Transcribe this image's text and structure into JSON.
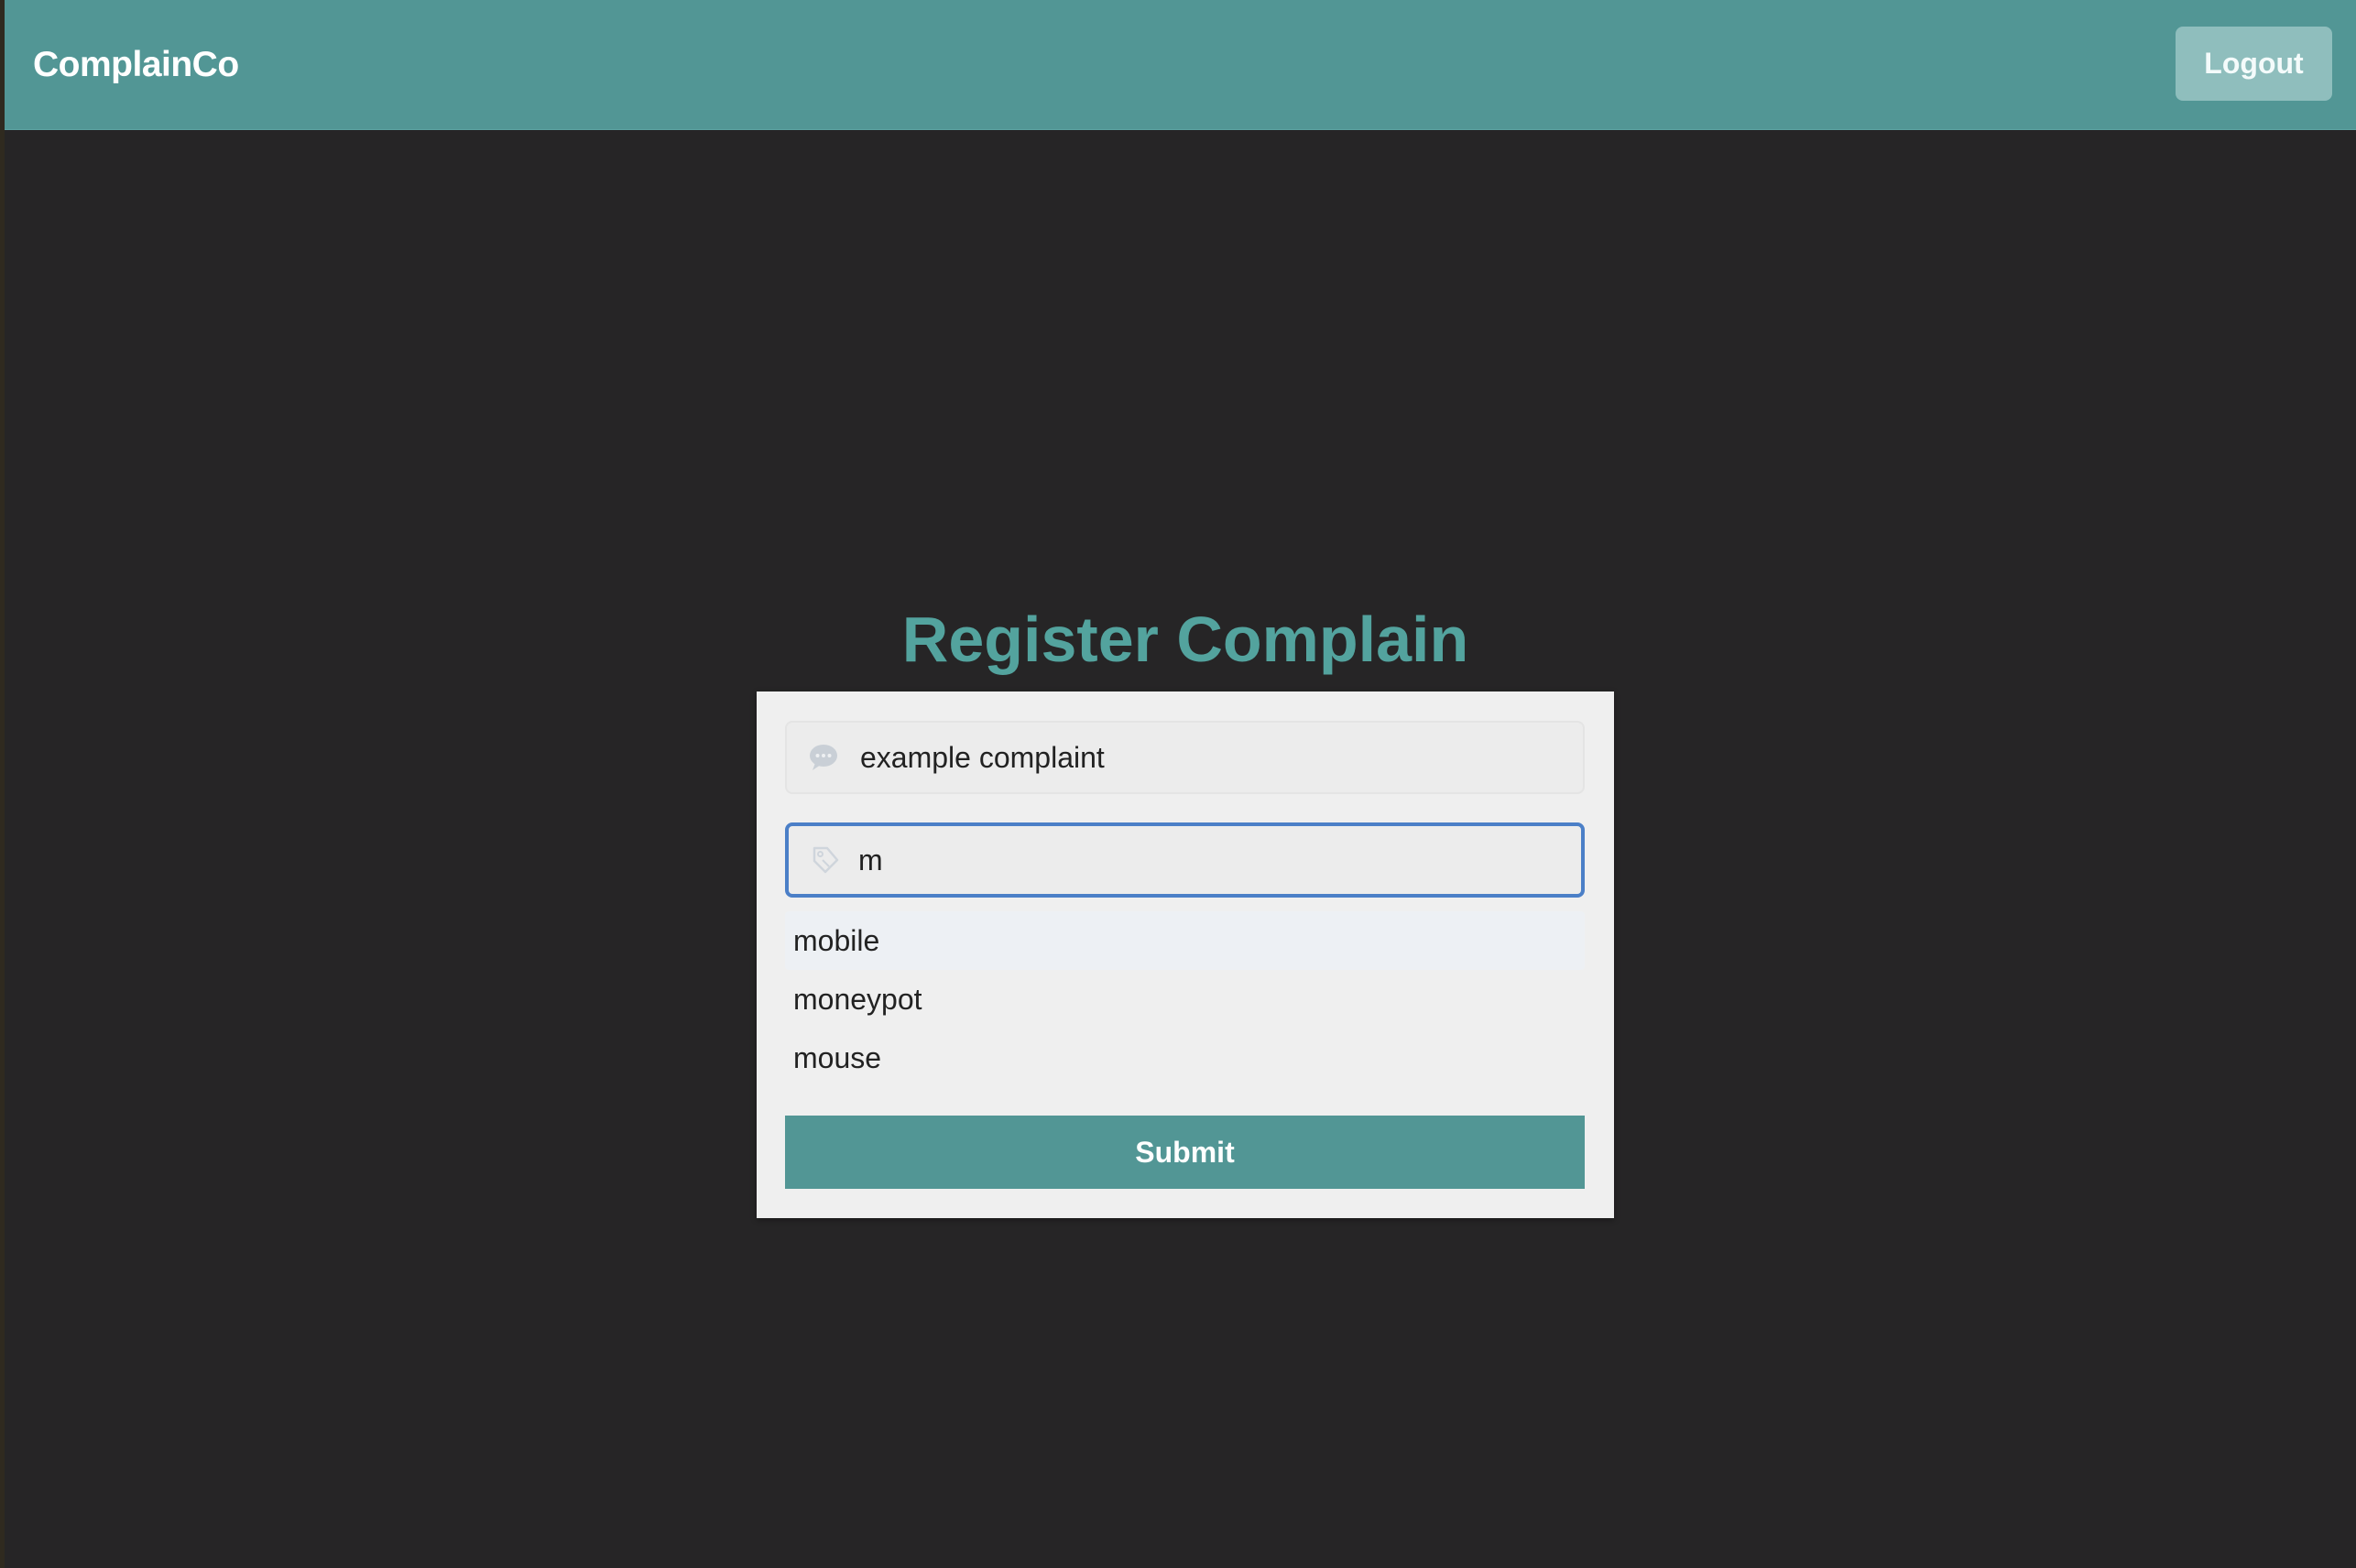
{
  "navbar": {
    "brand": "ComplainCo",
    "logout_label": "Logout",
    "color": "#529695"
  },
  "form": {
    "title": "Register Complain",
    "complaint": {
      "value": "example complaint",
      "icon": "comment-icon"
    },
    "product": {
      "value": "m",
      "icon": "tag-icon",
      "focused": true
    },
    "suggestions": [
      {
        "label": "mobile",
        "highlighted": true
      },
      {
        "label": "moneypot",
        "highlighted": false
      },
      {
        "label": "mouse",
        "highlighted": false
      }
    ],
    "submit_label": "Submit"
  },
  "colors": {
    "background": "#262526",
    "accent": "#529695",
    "title": "#53a39e",
    "focus_border": "#4b7fc7"
  }
}
